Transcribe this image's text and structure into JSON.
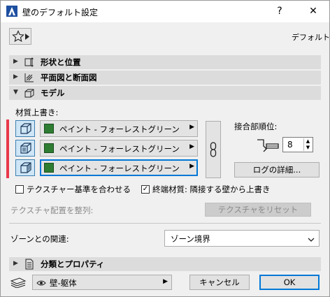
{
  "window": {
    "title": "壁のデフォルト設定",
    "help_label": "?",
    "close_label": "✕"
  },
  "toolbar": {
    "default_label": "デフォルト"
  },
  "sections": {
    "shape": "形状と位置",
    "plan": "平面図と断面図",
    "model": "モデル",
    "classification": "分類とプロパティ"
  },
  "model": {
    "override_label": "材質上書き:",
    "materials": [
      "ペイント - フォーレストグリーン",
      "ペイント - フォーレストグリーン",
      "ペイント - フォーレストグリーン"
    ],
    "swatch_color": "#2e7d32",
    "junction_label": "接合部順位:",
    "junction_value": "8",
    "log_button": "ログの詳細...",
    "texture_align_label": "テクスチャー基準を合わせる",
    "texture_align_checked": false,
    "end_material_label": "終端材質: 隣接する壁から上書き",
    "end_material_checked": true,
    "texture_arrange_label": "テクスチャ配置を整列:",
    "texture_reset_button": "テクスチャをリセット"
  },
  "zone": {
    "label": "ゾーンとの関連:",
    "value": "ゾーン境界"
  },
  "footer": {
    "layer_value": "壁-躯体",
    "cancel_label": "キャンセル",
    "ok_label": "OK"
  }
}
